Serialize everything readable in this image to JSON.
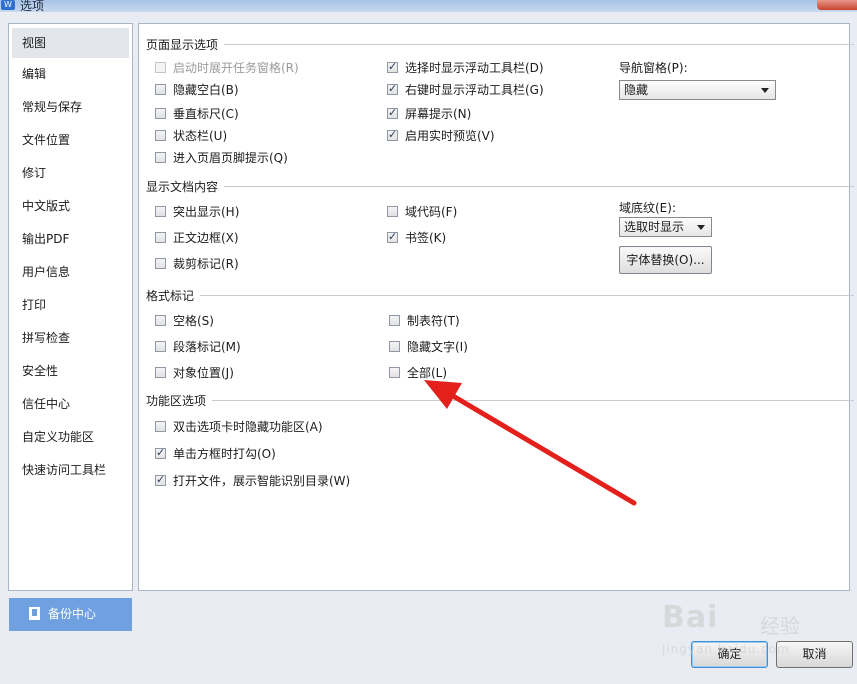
{
  "window": {
    "title": "选项",
    "app_icon": "W"
  },
  "nav": {
    "items": [
      {
        "label": "视图",
        "selected": true
      },
      {
        "label": "编辑"
      },
      {
        "label": "常规与保存"
      },
      {
        "label": "文件位置"
      },
      {
        "label": "修订"
      },
      {
        "label": "中文版式"
      },
      {
        "label": "输出PDF"
      },
      {
        "label": "用户信息"
      },
      {
        "label": "打印"
      },
      {
        "label": "拼写检查"
      },
      {
        "label": "安全性"
      },
      {
        "label": "信任中心"
      },
      {
        "label": "自定义功能区"
      },
      {
        "label": "快速访问工具栏"
      }
    ],
    "backup_label": "备份中心"
  },
  "page_display": {
    "heading": "页面显示选项",
    "opt_taskpane": {
      "label": "启动时展开任务窗格(R)",
      "checked": false,
      "disabled": true
    },
    "opt_hide_blank": {
      "label": "隐藏空白(B)",
      "checked": false
    },
    "opt_vruler": {
      "label": "垂直标尺(C)",
      "checked": false
    },
    "opt_statusbar": {
      "label": "状态栏(U)",
      "checked": false
    },
    "opt_header_tip": {
      "label": "进入页眉页脚提示(Q)",
      "checked": false
    },
    "opt_float_toolbar": {
      "label": "选择时显示浮动工具栏(D)",
      "checked": true
    },
    "opt_rclick_toolbar": {
      "label": "右键时显示浮动工具栏(G)",
      "checked": true
    },
    "opt_screen_tip": {
      "label": "屏幕提示(N)",
      "checked": true
    },
    "opt_live_preview": {
      "label": "启用实时预览(V)",
      "checked": true
    },
    "nav_pane_label": "导航窗格(P):",
    "nav_pane_value": "隐藏"
  },
  "doc_content": {
    "heading": "显示文档内容",
    "opt_highlight": {
      "label": "突出显示(H)",
      "checked": false
    },
    "opt_text_border": {
      "label": "正文边框(X)",
      "checked": false
    },
    "opt_crop_marks": {
      "label": "裁剪标记(R)",
      "checked": false
    },
    "opt_field_code": {
      "label": "域代码(F)",
      "checked": false
    },
    "opt_bookmark": {
      "label": "书签(K)",
      "checked": true
    },
    "field_shading_label": "域底纹(E):",
    "field_shading_value": "选取时显示",
    "font_replace_label": "字体替换(O)..."
  },
  "format_marks": {
    "heading": "格式标记",
    "opt_space": {
      "label": "空格(S)",
      "checked": false
    },
    "opt_paragraph": {
      "label": "段落标记(M)",
      "checked": false
    },
    "opt_object_pos": {
      "label": "对象位置(J)",
      "checked": false
    },
    "opt_tab": {
      "label": "制表符(T)",
      "checked": false
    },
    "opt_hidden_text": {
      "label": "隐藏文字(I)",
      "checked": false
    },
    "opt_all": {
      "label": "全部(L)",
      "checked": false
    }
  },
  "ribbon": {
    "heading": "功能区选项",
    "opt_dblclick_hide": {
      "label": "双击选项卡时隐藏功能区(A)",
      "checked": false
    },
    "opt_click_check": {
      "label": "单击方框时打勾(O)",
      "checked": true
    },
    "opt_smart_toc": {
      "label": "打开文件，展示智能识别目录(W)",
      "checked": true
    }
  },
  "footer": {
    "ok_label": "确定",
    "cancel_label": "取消"
  },
  "watermark": {
    "brand": "Bai",
    "cn": "经验",
    "url": "jingyan.baidu.com"
  },
  "colors": {
    "accent": "#6fa0e0",
    "annotation_arrow": "#e3201b"
  }
}
